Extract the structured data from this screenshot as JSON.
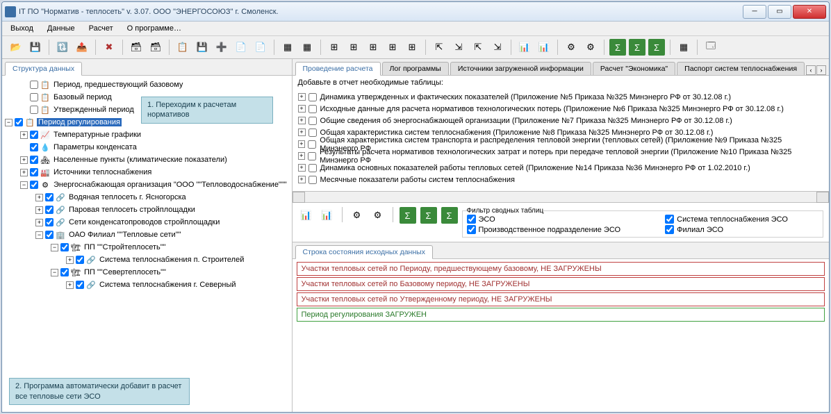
{
  "window": {
    "title": "IT ПО \"Норматив - теплосеть\" v. 3.07. ООО \"ЭНЕРГОСОЮЗ\" г. Смоленск."
  },
  "menu": {
    "exit": "Выход",
    "data": "Данные",
    "calc": "Расчет",
    "about": "О программе…"
  },
  "left": {
    "tab": "Структура данных",
    "callout1": "1. Переходим к расчетам нормативов",
    "callout2": "2. Программа автоматически добавит в расчет все тепловые сети ЭСО",
    "tree": {
      "n0": "Период, предшествующий базовому",
      "n1": "Базовый период",
      "n2": "Утвержденный период",
      "n3": "Период регулирования",
      "n4": "Температурные графики",
      "n5": "Параметры конденсата",
      "n6": "Населенные пункты (климатические показатели)",
      "n7": "Источники теплоснабжения",
      "n8": "Энергоснабжающая организация \"ООО \"\"Тепловодоснабжение\"\"\"",
      "n9": "Водяная теплосеть г. Ясногорска",
      "n10": "Паровая теплосеть стройплощадки",
      "n11": "Сети конденсатопроводов стройплощадки",
      "n12": "ОАО Филиал \"\"Тепловые сети\"\"",
      "n13": "ПП \"\"Стройтеплосеть\"\"",
      "n14": "Система теплоснабжения п. Строителей",
      "n15": "ПП \"\"Севертеплосеть\"\"",
      "n16": "Система теплоснабжения г. Северный"
    }
  },
  "right": {
    "tabs": {
      "t0": "Проведение расчета",
      "t1": "Лог программы",
      "t2": "Источники загруженной информации",
      "t3": "Расчет \"Экономика\"",
      "t4": "Паспорт систем теплоснабжения"
    },
    "report_head": "Добавьте в отчет необходимые таблицы:",
    "reports": {
      "r0": "Динамика утвержденных и фактических показателей (Приложение №5 Приказа №325 Минэнерго РФ от 30.12.08 г.)",
      "r1": "Исходные данные для расчета нормативов технологических потерь (Приложение №6 Приказа №325 Минэнерго РФ от 30.12.08 г.)",
      "r2": "Общие сведения об энергоснабжающей организации (Приложение №7 Приказа №325 Минэнерго РФ от 30.12.08 г.)",
      "r3": "Общая характеристика систем теплоснабжения (Приложение №8 Приказа №325 Минэнерго РФ от 30.12.08 г.)",
      "r4": "Общая характеристика систем транспорта и распределения тепловой энергии (тепловых сетей) (Приложение №9 Приказа №325 Минэнерго РФ",
      "r5": "Результаты расчета нормативов технологических затрат и потерь при передаче тепловой энергии (Приложение №10 Приказа №325 Минэнерго РФ",
      "r6": "Динамика основных показателей работы тепловых сетей (Приложение №14 Приказа №36 Минэнерго РФ от 1.02.2010 г.)",
      "r7": "Месячные показатели работы систем теплоснабжения"
    },
    "filter": {
      "title": "Фильтр сводных таблиц",
      "f0": "ЭСО",
      "f1": "Система теплоснабжения ЭСО",
      "f2": "Производственное подразделение ЭСО",
      "f3": "Филиал ЭСО"
    },
    "status_tab": "Строка состояния исходных данных",
    "status": {
      "s0": "Участки тепловых сетей по Периоду, предшествующему базовому, НЕ ЗАГРУЖЕНЫ",
      "s1": "Участки тепловых сетей по Базовому периоду, НЕ ЗАГРУЖЕНЫ",
      "s2": "Участки тепловых сетей по Утвержденному периоду, НЕ ЗАГРУЖЕНЫ",
      "s3": "Период регулирования ЗАГРУЖЕН"
    }
  }
}
